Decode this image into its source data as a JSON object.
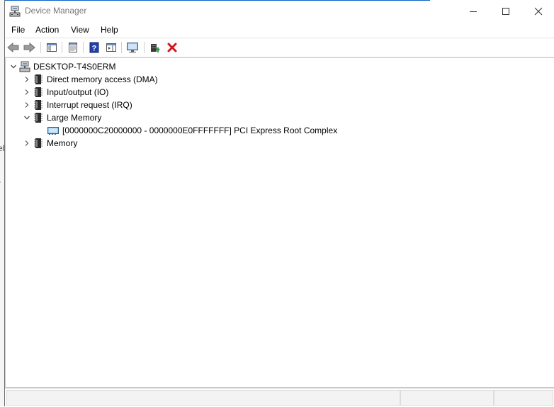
{
  "window": {
    "title": "Device Manager"
  },
  "menu": [
    "File",
    "Action",
    "View",
    "Help"
  ],
  "toolbar": {
    "icons": [
      "back-arrow-icon",
      "forward-arrow-icon",
      "show-hide-console-tree-icon",
      "properties-icon",
      "help-icon",
      "action-pane-icon",
      "monitor-icon",
      "update-driver-icon",
      "uninstall-device-icon"
    ]
  },
  "tree": {
    "root": "DESKTOP-T4S0ERM",
    "nodes": [
      {
        "label": "Direct memory access (DMA)",
        "expanded": false
      },
      {
        "label": "Input/output (IO)",
        "expanded": false
      },
      {
        "label": "Interrupt request (IRQ)",
        "expanded": false
      },
      {
        "label": "Large Memory",
        "expanded": true,
        "children": [
          {
            "label": "[0000000C20000000 - 0000000E0FFFFFFF]  PCI Express Root Complex"
          }
        ]
      },
      {
        "label": "Memory",
        "expanded": false
      }
    ]
  },
  "background": {
    "text1": "el",
    "text2": "r"
  },
  "colors": {
    "accent": "#0a64c8",
    "delete_red": "#d01818",
    "help_blue": "#2040b0"
  }
}
